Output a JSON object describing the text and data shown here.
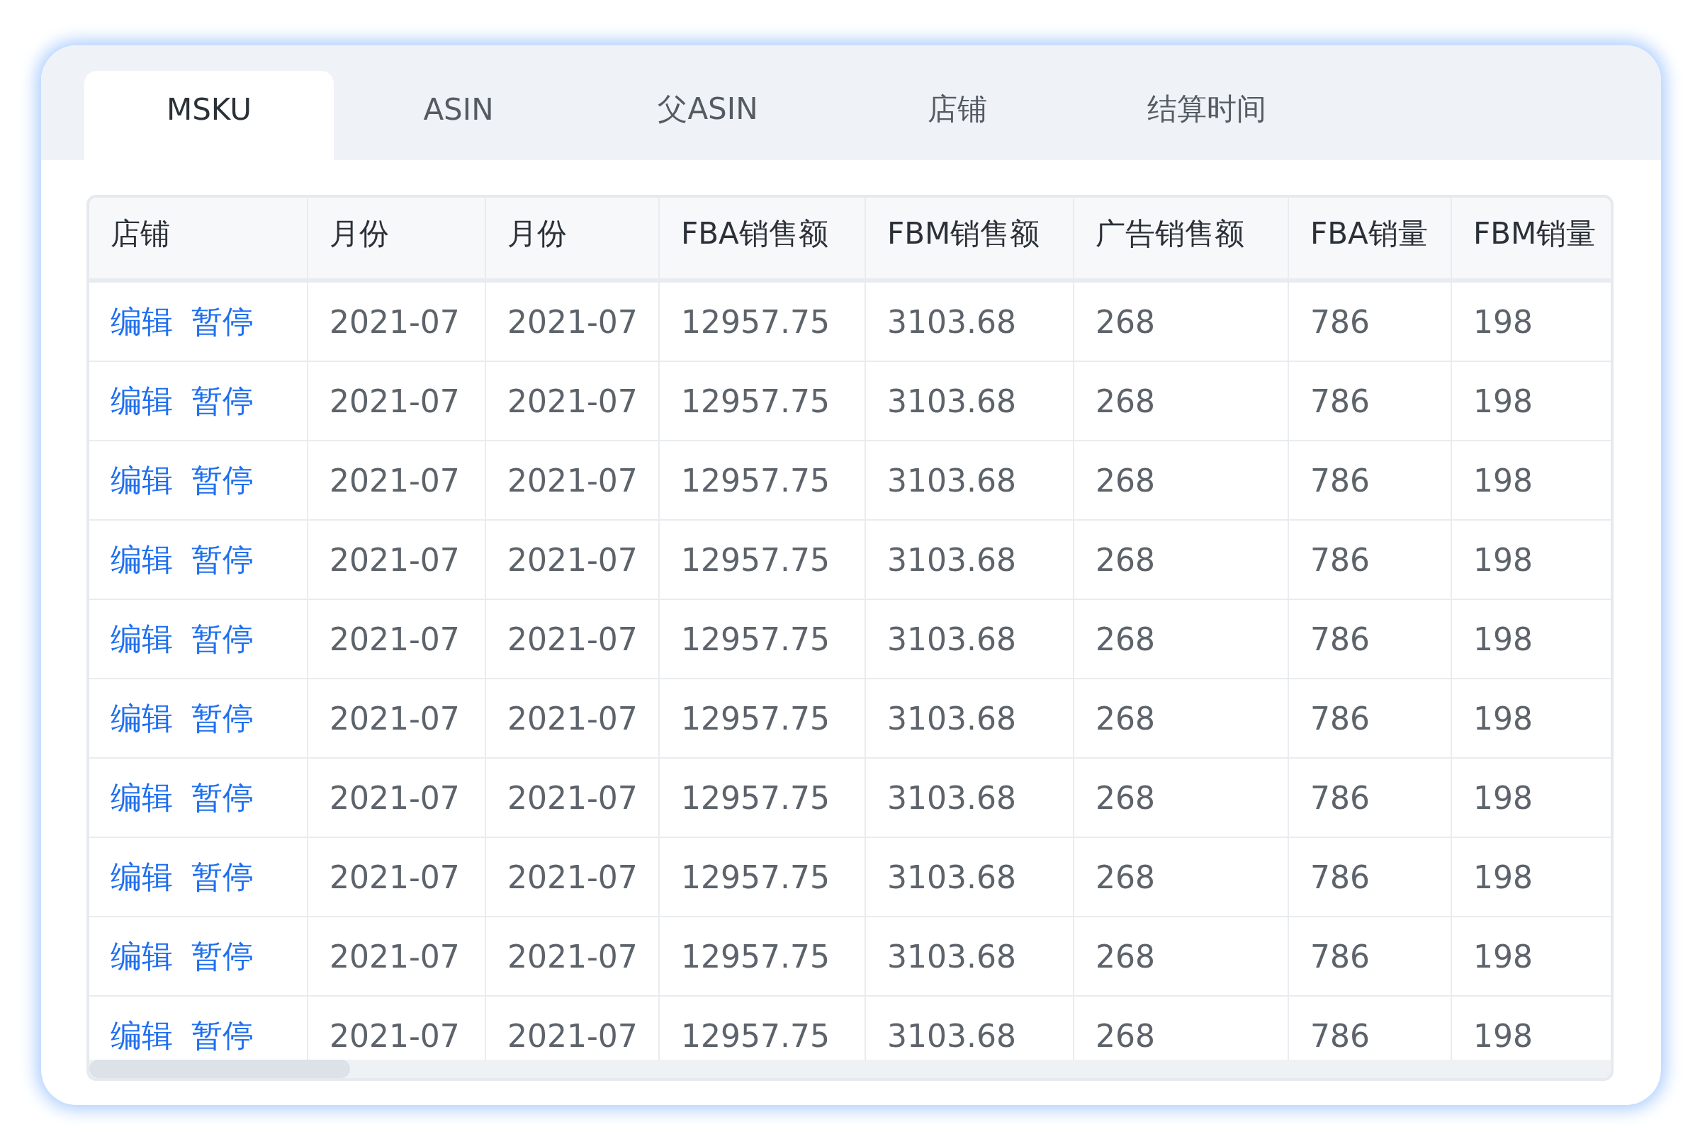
{
  "tabs": [
    {
      "label": "MSKU",
      "selected": true
    },
    {
      "label": "ASIN",
      "selected": false
    },
    {
      "label": "父ASIN",
      "selected": false
    },
    {
      "label": "店铺",
      "selected": false
    },
    {
      "label": "结算时间",
      "selected": false
    }
  ],
  "table": {
    "columns": [
      "店铺",
      "月份",
      "月份",
      "FBA销售额",
      "FBM销售额",
      "广告销售额",
      "FBA销量",
      "FBM销量"
    ],
    "rows": [
      {
        "cells": [
          [
            "编辑",
            "暂停"
          ],
          "2021-07",
          "2021-07",
          "12957.75",
          "3103.68",
          "268",
          "786",
          "198"
        ]
      },
      {
        "cells": [
          [
            "编辑",
            "暂停"
          ],
          "2021-07",
          "2021-07",
          "12957.75",
          "3103.68",
          "268",
          "786",
          "198"
        ]
      },
      {
        "cells": [
          [
            "编辑",
            "暂停"
          ],
          "2021-07",
          "2021-07",
          "12957.75",
          "3103.68",
          "268",
          "786",
          "198"
        ]
      },
      {
        "cells": [
          [
            "编辑",
            "暂停"
          ],
          "2021-07",
          "2021-07",
          "12957.75",
          "3103.68",
          "268",
          "786",
          "198"
        ]
      },
      {
        "cells": [
          [
            "编辑",
            "暂停"
          ],
          "2021-07",
          "2021-07",
          "12957.75",
          "3103.68",
          "268",
          "786",
          "198"
        ]
      },
      {
        "cells": [
          [
            "编辑",
            "暂停"
          ],
          "2021-07",
          "2021-07",
          "12957.75",
          "3103.68",
          "268",
          "786",
          "198"
        ]
      },
      {
        "cells": [
          [
            "编辑",
            "暂停"
          ],
          "2021-07",
          "2021-07",
          "12957.75",
          "3103.68",
          "268",
          "786",
          "198"
        ]
      },
      {
        "cells": [
          [
            "编辑",
            "暂停"
          ],
          "2021-07",
          "2021-07",
          "12957.75",
          "3103.68",
          "268",
          "786",
          "198"
        ]
      },
      {
        "cells": [
          [
            "编辑",
            "暂停"
          ],
          "2021-07",
          "2021-07",
          "12957.75",
          "3103.68",
          "268",
          "786",
          "198"
        ]
      },
      {
        "cells": [
          [
            "编辑",
            "暂停"
          ],
          "2021-07",
          "2021-07",
          "12957.75",
          "3103.68",
          "268",
          "786",
          "198"
        ]
      }
    ]
  }
}
